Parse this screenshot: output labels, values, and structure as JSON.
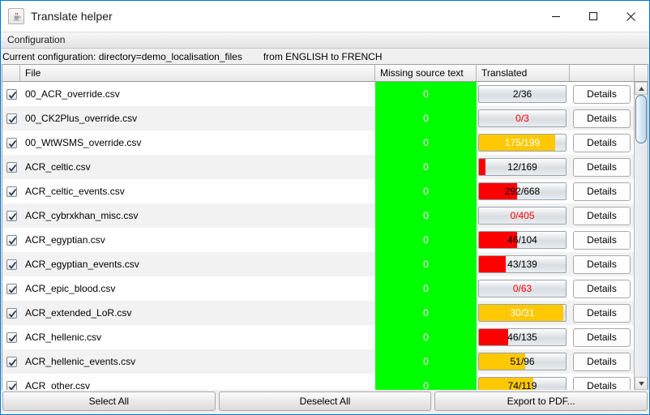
{
  "window": {
    "title": "Translate helper",
    "icon": "java-coffee-cup-icon",
    "minimize_label": "—",
    "maximize_label": "□",
    "close_label": "✕"
  },
  "menubar": {
    "items": [
      {
        "label": "Configuration"
      }
    ]
  },
  "configbar": {
    "config_text": "Current configuration: directory=demo_localisation_files",
    "languages_text": "from ENGLISH to FRENCH"
  },
  "table": {
    "headers": {
      "checkbox": "",
      "file": "File",
      "missing": "Missing source text",
      "translated": "Translated",
      "details": ""
    },
    "details_label": "Details",
    "rows": [
      {
        "checked": true,
        "file": "00_ACR_override.csv",
        "missing": "0",
        "translated": "2/36",
        "value": 2,
        "max": 36,
        "bar_color": "none",
        "text_color": "#000000"
      },
      {
        "checked": true,
        "file": "00_CK2Plus_override.csv",
        "missing": "0",
        "translated": "0/3",
        "value": 0,
        "max": 3,
        "bar_color": "none",
        "text_color": "#ff0000"
      },
      {
        "checked": true,
        "file": "00_WtWSMS_override.csv",
        "missing": "0",
        "translated": "175/199",
        "value": 175,
        "max": 199,
        "bar_color": "#ffc800",
        "text_color": "#ffffff"
      },
      {
        "checked": true,
        "file": "ACR_celtic.csv",
        "missing": "0",
        "translated": "12/169",
        "value": 12,
        "max": 169,
        "bar_color": "#ff0000",
        "text_color": "#000000"
      },
      {
        "checked": true,
        "file": "ACR_celtic_events.csv",
        "missing": "0",
        "translated": "292/668",
        "value": 292,
        "max": 668,
        "bar_color": "#ff0000",
        "text_color": "#000000"
      },
      {
        "checked": true,
        "file": "ACR_cybrxkhan_misc.csv",
        "missing": "0",
        "translated": "0/405",
        "value": 0,
        "max": 405,
        "bar_color": "none",
        "text_color": "#ff0000"
      },
      {
        "checked": true,
        "file": "ACR_egyptian.csv",
        "missing": "0",
        "translated": "46/104",
        "value": 46,
        "max": 104,
        "bar_color": "#ff0000",
        "text_color": "#000000"
      },
      {
        "checked": true,
        "file": "ACR_egyptian_events.csv",
        "missing": "0",
        "translated": "43/139",
        "value": 43,
        "max": 139,
        "bar_color": "#ff0000",
        "text_color": "#000000"
      },
      {
        "checked": true,
        "file": "ACR_epic_blood.csv",
        "missing": "0",
        "translated": "0/63",
        "value": 0,
        "max": 63,
        "bar_color": "none",
        "text_color": "#ff0000"
      },
      {
        "checked": true,
        "file": "ACR_extended_LoR.csv",
        "missing": "0",
        "translated": "30/31",
        "value": 30,
        "max": 31,
        "bar_color": "#ffc800",
        "text_color": "#ffffff"
      },
      {
        "checked": true,
        "file": "ACR_hellenic.csv",
        "missing": "0",
        "translated": "46/135",
        "value": 46,
        "max": 135,
        "bar_color": "#ff0000",
        "text_color": "#000000"
      },
      {
        "checked": true,
        "file": "ACR_hellenic_events.csv",
        "missing": "0",
        "translated": "51/96",
        "value": 51,
        "max": 96,
        "bar_color": "#ffc800",
        "text_color": "#000000"
      },
      {
        "checked": true,
        "file": "ACR_other.csv",
        "missing": "0",
        "translated": "74/119",
        "value": 74,
        "max": 119,
        "bar_color": "#ffc800",
        "text_color": "#000000"
      }
    ]
  },
  "scrollbar": {
    "up_arrow": "▲",
    "down_arrow": "▼"
  },
  "footer": {
    "select_all": "Select All",
    "deselect_all": "Deselect All",
    "export_pdf": "Export to PDF..."
  },
  "colors": {
    "missing_ok": "#00ff00",
    "bar_warn": "#ffc800",
    "bar_bad": "#ff0000",
    "accent": "#0078d7"
  }
}
